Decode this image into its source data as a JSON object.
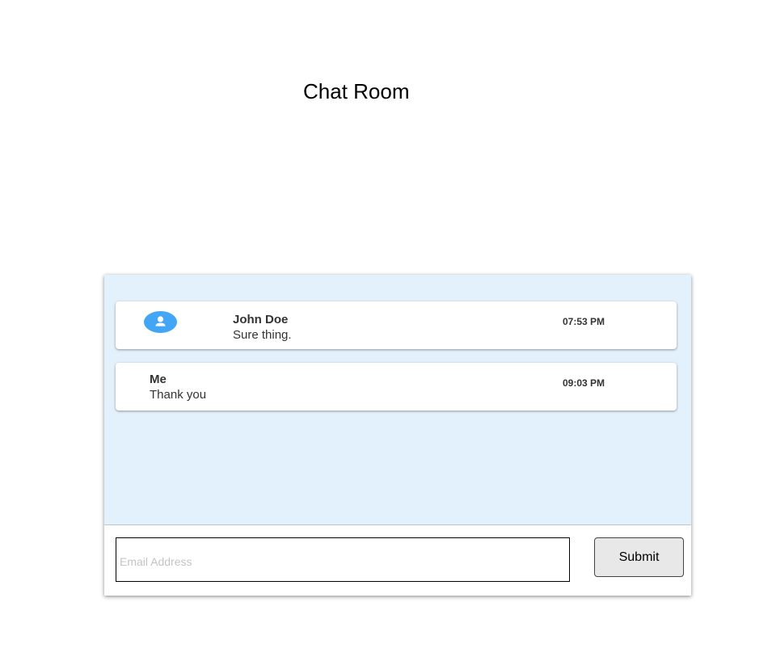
{
  "page": {
    "title": "Chat Room"
  },
  "messages": [
    {
      "sender": "John Doe",
      "text": "Sure thing.",
      "time": "07:53 PM",
      "avatar_icon": "person-icon",
      "avatar_color": "#42a5f5"
    },
    {
      "sender": "Me",
      "text": "Thank you",
      "time": "09:03 PM"
    }
  ],
  "composer": {
    "placeholder": "Email Address",
    "value": "",
    "submit_label": "Submit"
  },
  "colors": {
    "messages_background": "#e3f1fc",
    "accent": "#42a5f5"
  }
}
